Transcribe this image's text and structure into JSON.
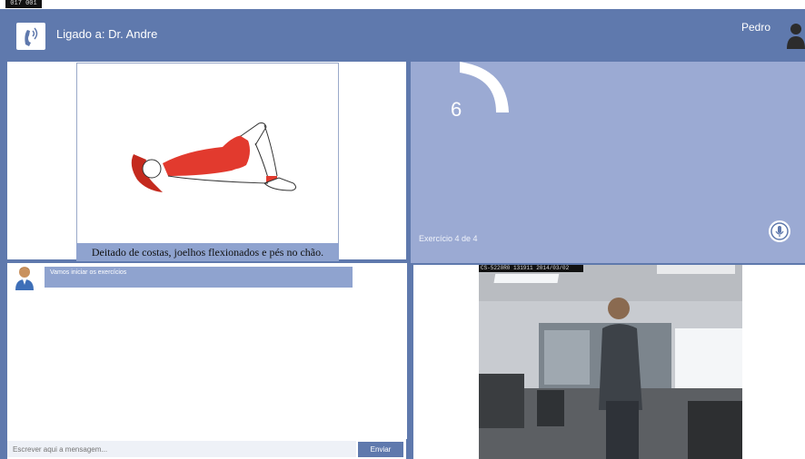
{
  "header": {
    "connection_label": "Ligado a: Dr. Andre",
    "user_name": "Pedro"
  },
  "window": {
    "recording_indicator": "017 001"
  },
  "exercise": {
    "caption": "Deitado de costas, joelhos flexionados e pés no chão.",
    "counter": "6",
    "progress_text": "Exercício 4 de 4"
  },
  "chat": {
    "messages": [
      {
        "text": "Vamos iniciar os exercícios"
      }
    ],
    "input_placeholder": "Escrever aqui a mensagem...",
    "send_label": "Enviar"
  },
  "camera": {
    "timestamp": "CS-5220R0  131911  2014/03/02"
  },
  "colors": {
    "header": "#5f79ad",
    "status_panel": "#9baad3",
    "caption_bg": "#8fa3cf",
    "exercise_shirt": "#e23a2e"
  },
  "icons": {
    "app": "phone-signal-icon",
    "user": "user-silhouette-icon",
    "mic": "microphone-icon",
    "chat_avatar": "doctor-avatar-icon"
  }
}
